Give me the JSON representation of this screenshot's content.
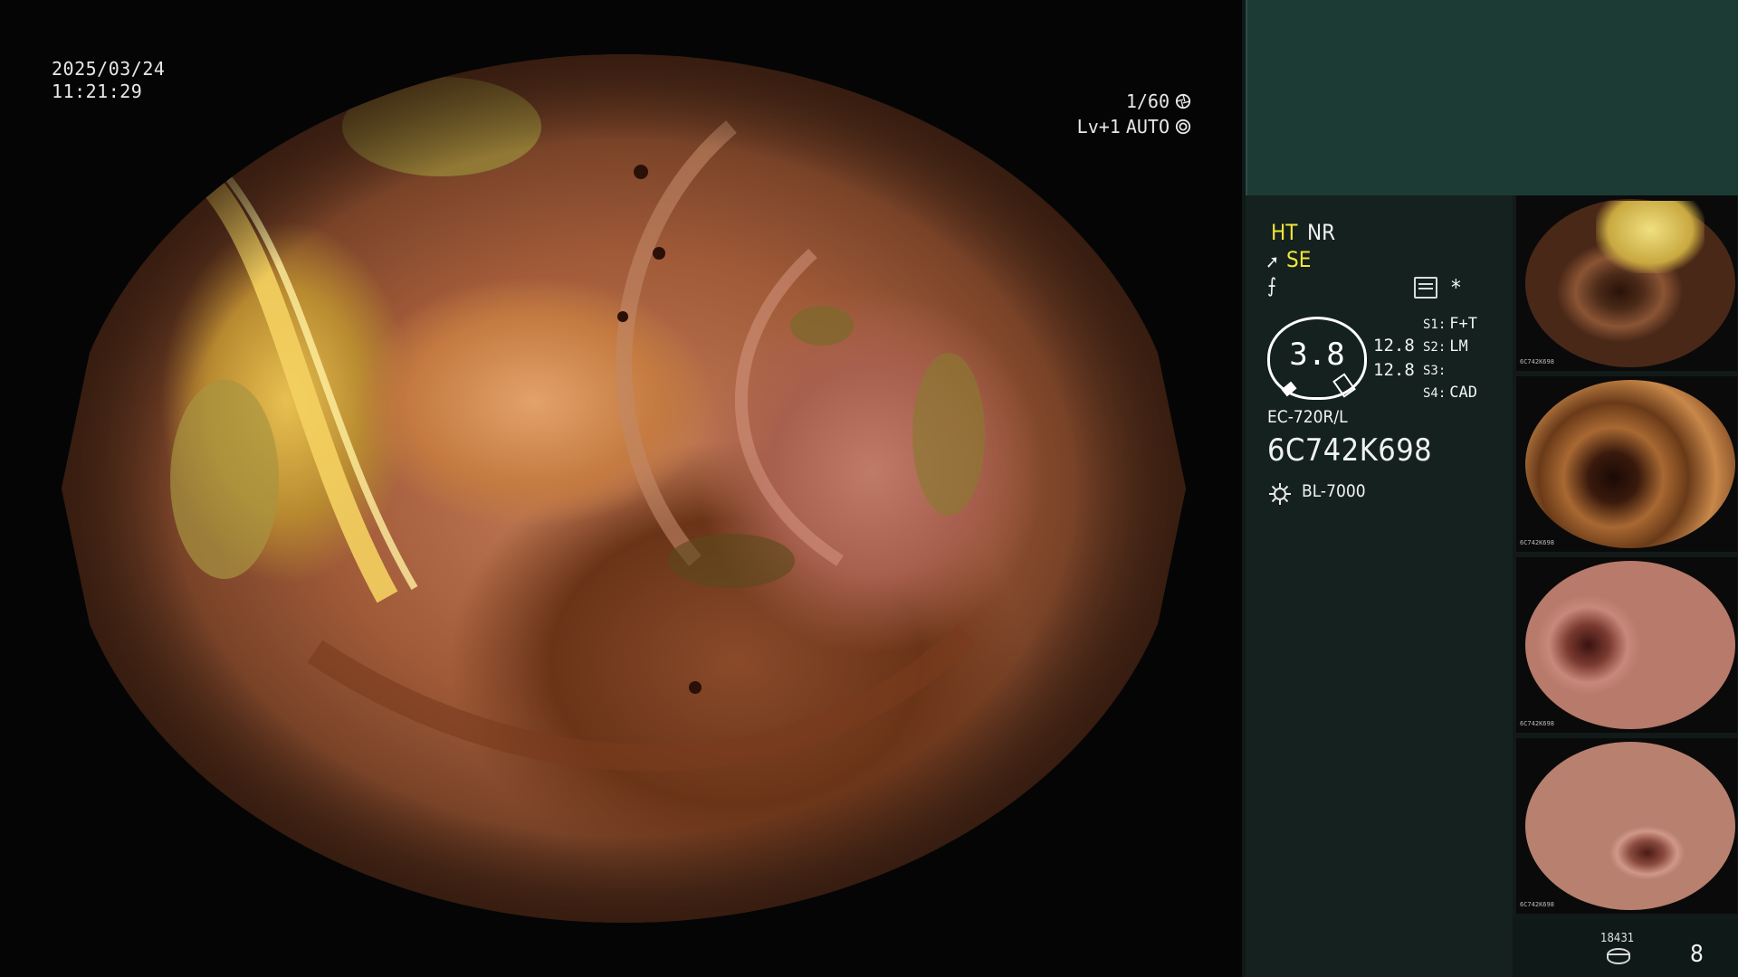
{
  "osd": {
    "date": "2025/03/24",
    "time": "11:21:29",
    "shutter": "1/60",
    "level": "Lv+1",
    "iris": "AUTO"
  },
  "settings": {
    "ht": "HT",
    "nr": "NR",
    "se": "SE",
    "hook_glyph": "⨍",
    "star_glyph": "*",
    "gauge_value": "3.8",
    "val_top": "12.8",
    "val_bottom": "12.8",
    "switches": [
      {
        "key": "S1:",
        "value": "F+T"
      },
      {
        "key": "S2:",
        "value": "LM"
      },
      {
        "key": "S3:",
        "value": ""
      },
      {
        "key": "S4:",
        "value": "CAD"
      }
    ],
    "model": "EC-720R/L",
    "serial": "6C742K698",
    "light_source": "BL-7000"
  },
  "thumbnails": [
    {
      "stamp": "6C742K698"
    },
    {
      "stamp": "6C742K698"
    },
    {
      "stamp": "6C742K698"
    },
    {
      "stamp": "6C742K698"
    }
  ],
  "footer": {
    "counter": "18431",
    "page": "8"
  },
  "colors": {
    "accent_yellow": "#f2e43a",
    "panel_teal": "#1c3b35"
  }
}
